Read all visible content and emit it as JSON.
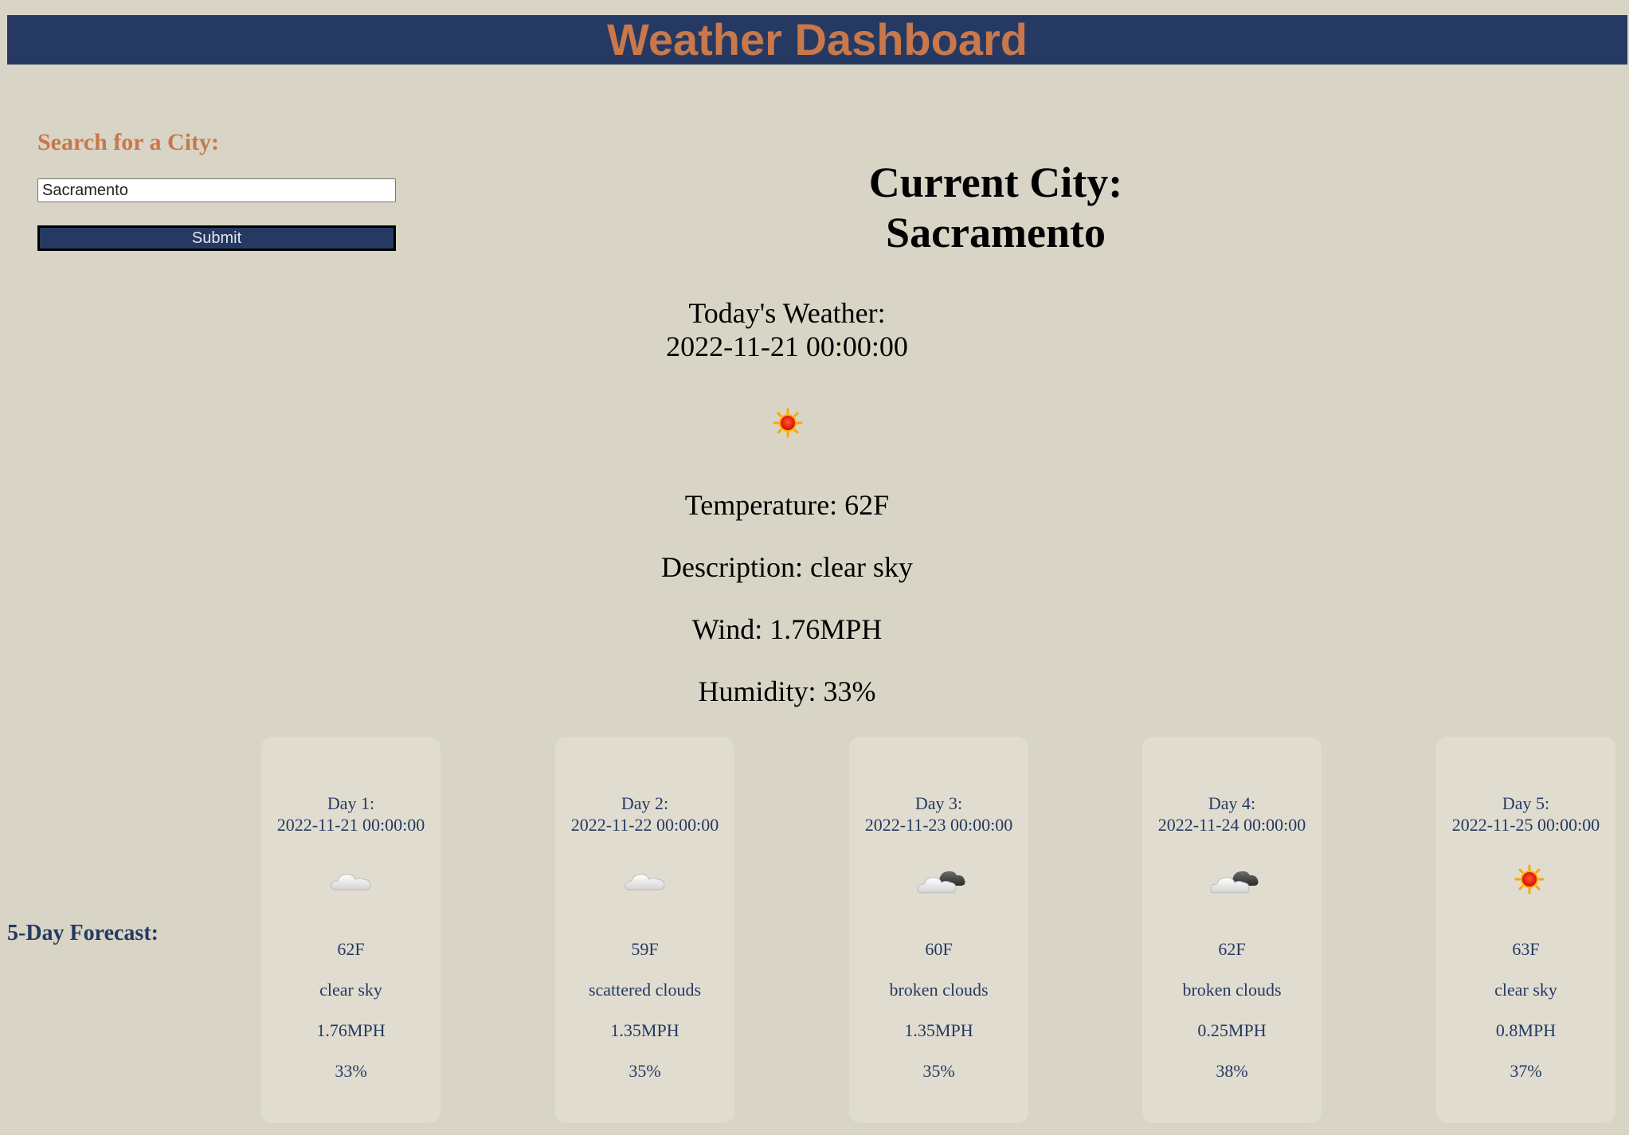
{
  "header": {
    "title": "Weather Dashboard"
  },
  "search": {
    "label": "Search for a City:",
    "value": "Sacramento",
    "submit_label": "Submit"
  },
  "current": {
    "heading_line1": "Current City:",
    "heading_line2": "Sacramento",
    "today_label": "Today's Weather:",
    "datetime": "2022-11-21 00:00:00",
    "icon": "sun-icon",
    "temperature": "Temperature: 62F",
    "description": "Description: clear sky",
    "wind": "Wind: 1.76MPH",
    "humidity": "Humidity: 33%"
  },
  "forecast": {
    "label": "5-Day Forecast:",
    "days": [
      {
        "day": "Day 1:",
        "date": "2022-11-21 00:00:00",
        "icon": "cloud-icon",
        "temp": "62F",
        "desc": "clear sky",
        "wind": "1.76MPH",
        "humidity": "33%"
      },
      {
        "day": "Day 2:",
        "date": "2022-11-22 00:00:00",
        "icon": "cloud-icon",
        "temp": "59F",
        "desc": "scattered clouds",
        "wind": "1.35MPH",
        "humidity": "35%"
      },
      {
        "day": "Day 3:",
        "date": "2022-11-23 00:00:00",
        "icon": "broken-clouds-icon",
        "temp": "60F",
        "desc": "broken clouds",
        "wind": "1.35MPH",
        "humidity": "35%"
      },
      {
        "day": "Day 4:",
        "date": "2022-11-24 00:00:00",
        "icon": "broken-clouds-icon",
        "temp": "62F",
        "desc": "broken clouds",
        "wind": "0.25MPH",
        "humidity": "38%"
      },
      {
        "day": "Day 5:",
        "date": "2022-11-25 00:00:00",
        "icon": "sun-icon",
        "temp": "63F",
        "desc": "clear sky",
        "wind": "0.8MPH",
        "humidity": "37%"
      }
    ]
  },
  "colors": {
    "header_bg": "#253962",
    "accent": "#c8784a",
    "page_bg": "#d8d5c6",
    "card_bg": "#e0ddd0"
  }
}
